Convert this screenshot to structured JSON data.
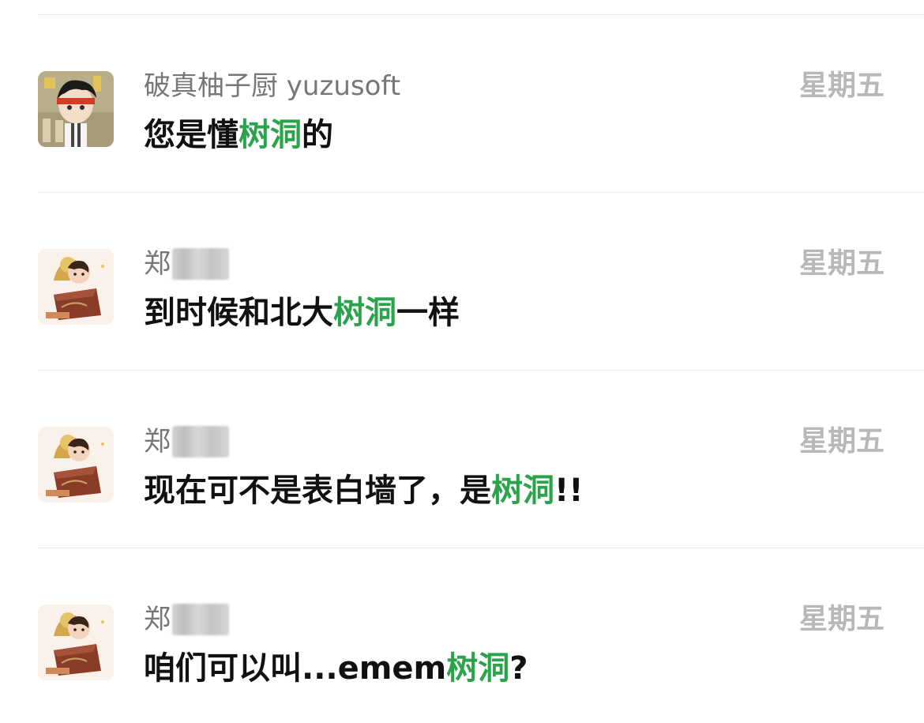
{
  "colors": {
    "highlight": "#2aa34a",
    "name_text": "#777777",
    "time_text": "#b8b8b8",
    "message_text": "#111111",
    "divider": "#e6e6e6"
  },
  "chats": [
    {
      "avatar_icon": "anime-character-avatar-icon",
      "name": "破真柚子厨 yuzusoft",
      "name_redacted": false,
      "time": "星期五",
      "message_before": "您是懂",
      "message_highlight": "树洞",
      "message_after": "的"
    },
    {
      "avatar_icon": "cartoon-boy-avatar-icon",
      "name": "郑",
      "name_redacted": true,
      "time": "星期五",
      "message_before": "到时候和北大",
      "message_highlight": "树洞",
      "message_after": "一样"
    },
    {
      "avatar_icon": "cartoon-boy-avatar-icon",
      "name": "郑",
      "name_redacted": true,
      "time": "星期五",
      "message_before": "现在可不是表白墙了，是",
      "message_highlight": "树洞",
      "message_after": "!!"
    },
    {
      "avatar_icon": "cartoon-boy-avatar-icon",
      "name": "郑",
      "name_redacted": true,
      "time": "星期五",
      "message_before": "咱们可以叫...emem",
      "message_highlight": "树洞",
      "message_after": "?"
    }
  ]
}
